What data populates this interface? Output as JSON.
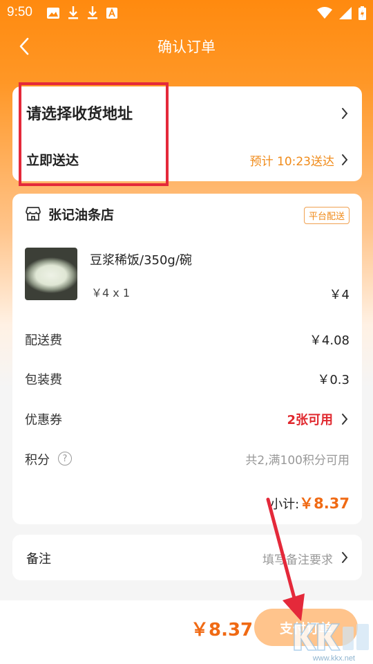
{
  "status_bar": {
    "time": "9:50",
    "left_icons": [
      "image-icon",
      "download-icon",
      "download-icon",
      "text-a-icon"
    ],
    "right_icons": [
      "wifi-icon",
      "signal-icon",
      "battery-icon"
    ]
  },
  "nav": {
    "title": "确认订单",
    "back_icon": "chevron-left-icon"
  },
  "address": {
    "title": "请选择收货地址",
    "delivery_label": "立即送达",
    "delivery_eta": "预计 10:23送达"
  },
  "order": {
    "shop_name": "张记油条店",
    "badge": "平台配送",
    "product": {
      "name": "豆浆稀饭/350g/碗",
      "unit_qty": "￥4 x 1",
      "total": "￥4"
    },
    "fees": {
      "delivery_label": "配送费",
      "delivery_value": "￥4.08",
      "packing_label": "包装费",
      "packing_value": "￥0.3",
      "coupon_label": "优惠券",
      "coupon_value": "2张可用",
      "points_label": "积分",
      "points_help": "?",
      "points_value": "共2,满100积分可用"
    },
    "subtotal_label": "小计:",
    "subtotal_amount": "￥8.37"
  },
  "remark": {
    "label": "备注",
    "placeholder": "填写备注要求"
  },
  "bottom": {
    "total": "￥8.37",
    "pay_label": "支付订单"
  },
  "annotation": {
    "box_color": "#e4293a",
    "arrow_color": "#e4293a"
  },
  "watermark": {
    "text": "www.kkx.net",
    "logo_icon": "kkx-logo-icon"
  },
  "colors": {
    "brand_orange": "#ff8a0f",
    "price_orange": "#f06a14",
    "coupon_red": "#e0282e",
    "pay_button": "#ffc48c"
  }
}
